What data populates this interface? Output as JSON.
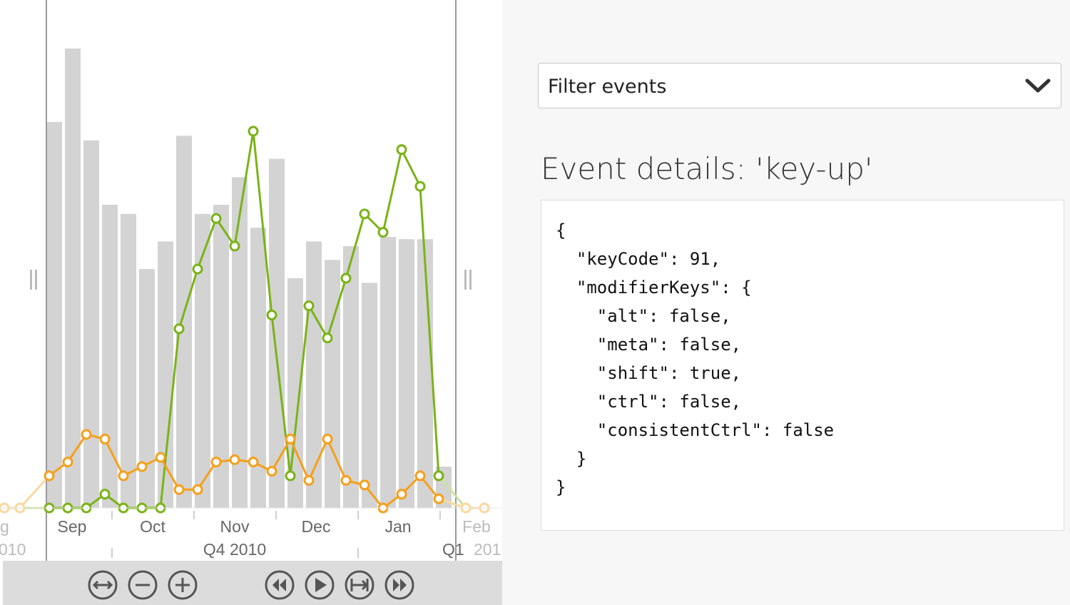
{
  "chart_data": {
    "type": "bar+line",
    "bars": {
      "values": [
        84,
        100,
        80,
        66,
        64,
        52,
        58,
        81,
        64,
        66,
        72,
        61,
        76,
        50,
        58,
        54,
        57,
        49,
        59,
        58.5,
        58.5,
        9
      ]
    },
    "series": [
      {
        "color": "#7ab317",
        "values": [
          0,
          0,
          0,
          3,
          0,
          0,
          0,
          39,
          52,
          63,
          57,
          82,
          42,
          7,
          44,
          37,
          50,
          64,
          60,
          78,
          70,
          7
        ],
        "fade_values": [
          0,
          0
        ]
      },
      {
        "color": "#f5a01a",
        "values": [
          7,
          10,
          16,
          15,
          7,
          9,
          11,
          4,
          4,
          10,
          10.5,
          10,
          8,
          15,
          6,
          15,
          6,
          5,
          0,
          3,
          7,
          2
        ],
        "fade_values": [
          0,
          0
        ]
      }
    ],
    "months": [
      "Sep",
      "Oct",
      "Nov",
      "Dec",
      "Jan",
      "Feb"
    ],
    "quarter_label": "Q4  2010",
    "edge_labels": {
      "left_partial_month": "g",
      "left_partial_year": "010",
      "right_quarter": "Q1",
      "right_year": "201"
    },
    "ylim": [
      0,
      100
    ]
  },
  "toolbar": {
    "buttons": [
      {
        "name": "fit-range-button",
        "icon": "fit-arrows-icon"
      },
      {
        "name": "zoom-out-button",
        "icon": "minus-circle-icon"
      },
      {
        "name": "zoom-in-button",
        "icon": "plus-circle-icon"
      },
      {
        "name": "rewind-button",
        "icon": "rewind-icon"
      },
      {
        "name": "play-button",
        "icon": "play-icon"
      },
      {
        "name": "step-to-end-button",
        "icon": "step-end-icon"
      },
      {
        "name": "fast-forward-button",
        "icon": "fast-forward-icon"
      }
    ]
  },
  "filter": {
    "label": "Filter events"
  },
  "details": {
    "title": "Event details: 'key-up'",
    "json": "{\n  \"keyCode\": 91,\n  \"modifierKeys\": {\n    \"alt\": false,\n    \"meta\": false,\n    \"shift\": true,\n    \"ctrl\": false,\n    \"consistentCtrl\": false\n  }\n}"
  },
  "colors": {
    "bar": "#d3d3d3",
    "green_series": "#7ab317",
    "orange_series": "#f5a01a",
    "toolbar_bg": "#dcdcdc"
  }
}
